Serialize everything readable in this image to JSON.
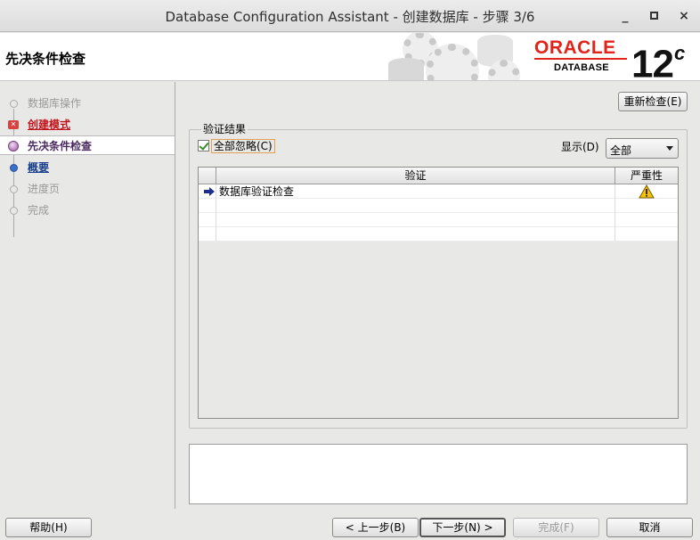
{
  "window": {
    "title": "Database Configuration Assistant - 创建数据库 - 步骤 3/6",
    "minimize": "_",
    "maximize": "□",
    "close": "×"
  },
  "header": {
    "page_title": "先决条件检查",
    "brand_word": "ORACLE",
    "brand_sub": "DATABASE",
    "version": "12",
    "version_suffix": "c",
    "brand_color": "#e2231a"
  },
  "sidebar": {
    "steps": [
      {
        "label": "数据库操作",
        "state": "done"
      },
      {
        "label": "创建模式",
        "state": "error"
      },
      {
        "label": "先决条件检查",
        "state": "current"
      },
      {
        "label": "概要",
        "state": "link"
      },
      {
        "label": "进度页",
        "state": "pending"
      },
      {
        "label": "完成",
        "state": "pending"
      }
    ]
  },
  "main": {
    "recheck_button": "重新检查(E)",
    "group_title": "验证结果",
    "ignore_all": {
      "label": "全部忽略(C)",
      "checked": true
    },
    "show_label": "显示(D)",
    "show_select": {
      "value": "全部"
    },
    "table": {
      "columns": [
        "验证",
        "严重性"
      ],
      "rows": [
        {
          "check": "数据库验证检查",
          "severity": "warning-icon"
        }
      ]
    }
  },
  "footer": {
    "help": "帮助(H)",
    "back": "< 上一步(B)",
    "next": "下一步(N) >",
    "finish": "完成(F)",
    "cancel": "取消"
  }
}
